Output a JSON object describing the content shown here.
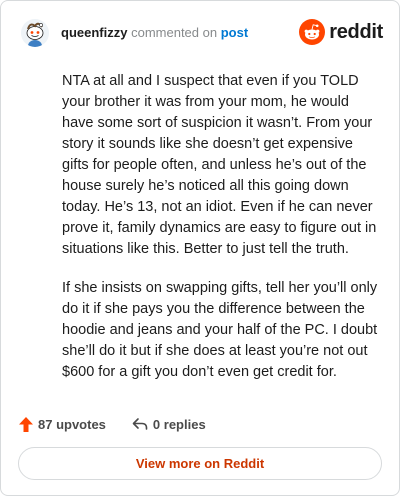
{
  "header": {
    "username": "queenfizzy",
    "commented_text": "commented on",
    "post_link": "post",
    "logo_word": "reddit",
    "brand_color": "#ff4500"
  },
  "comment": {
    "paragraphs": [
      "NTA at all and I suspect that even if you TOLD your brother it was from your mom, he would have some sort of suspicion it wasn’t. From your story it sounds like she doesn’t get expensive gifts for people often, and unless he’s out of the house surely he’s noticed all this going down today. He’s 13, not an idiot. Even if he can never prove it, family dynamics are easy to figure out in situations like this. Better to just tell the truth.",
      "If she insists on swapping gifts, tell her you’ll only do it if she pays you the difference between the hoodie and jeans and your half of the PC. I doubt she’ll do it but if she does at least you’re not out $600 for a gift you don’t even get credit for."
    ]
  },
  "actions": {
    "upvotes": "87 upvotes",
    "replies": "0 replies"
  },
  "footer": {
    "view_more": "View more on Reddit"
  },
  "icons": {
    "avatar": "snoo-avatar",
    "logo": "reddit-snoo-icon",
    "upvote": "upvote-arrow-icon",
    "reply": "reply-arrow-icon"
  }
}
